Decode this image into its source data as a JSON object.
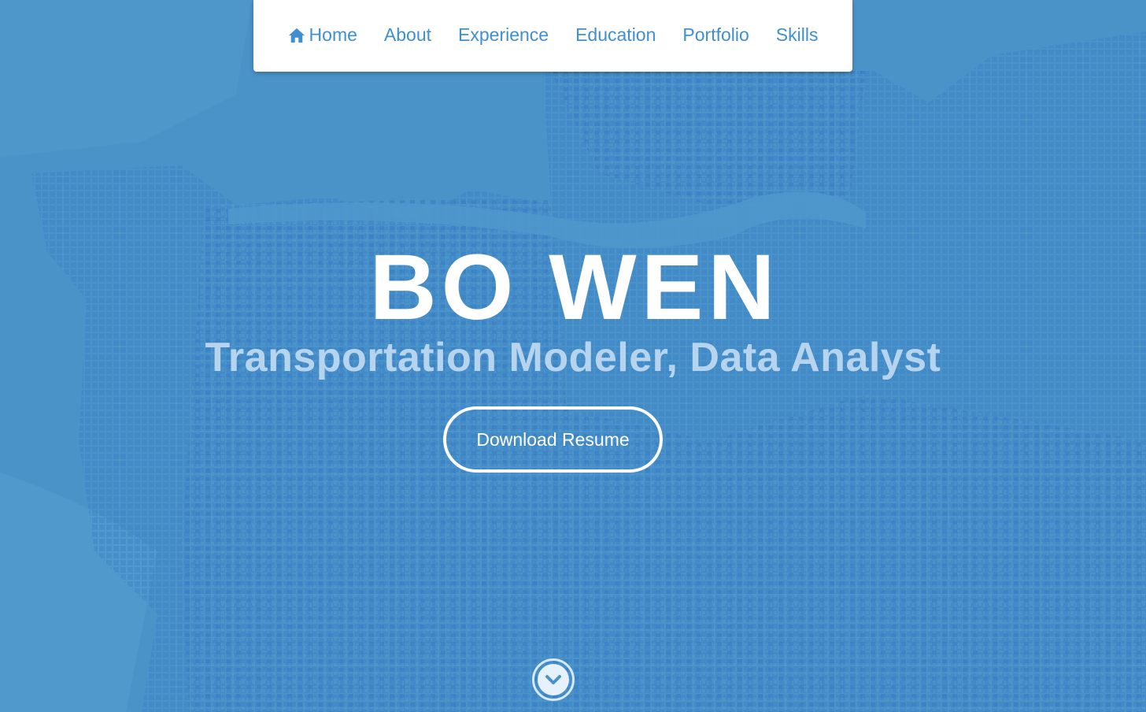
{
  "nav": {
    "items": [
      {
        "label": "Home",
        "icon": "home-icon"
      },
      {
        "label": "About"
      },
      {
        "label": "Experience"
      },
      {
        "label": "Education"
      },
      {
        "label": "Portfolio"
      },
      {
        "label": "Skills"
      }
    ]
  },
  "hero": {
    "name": "BO WEN",
    "tagline": "Transportation Modeler, Data Analyst",
    "resume_label": "Download Resume",
    "scroll_icon": "chevron-down-icon"
  },
  "colors": {
    "background": "#4a93c9",
    "accent": "#3f8fd1",
    "tagline": "#b7d4ef"
  }
}
